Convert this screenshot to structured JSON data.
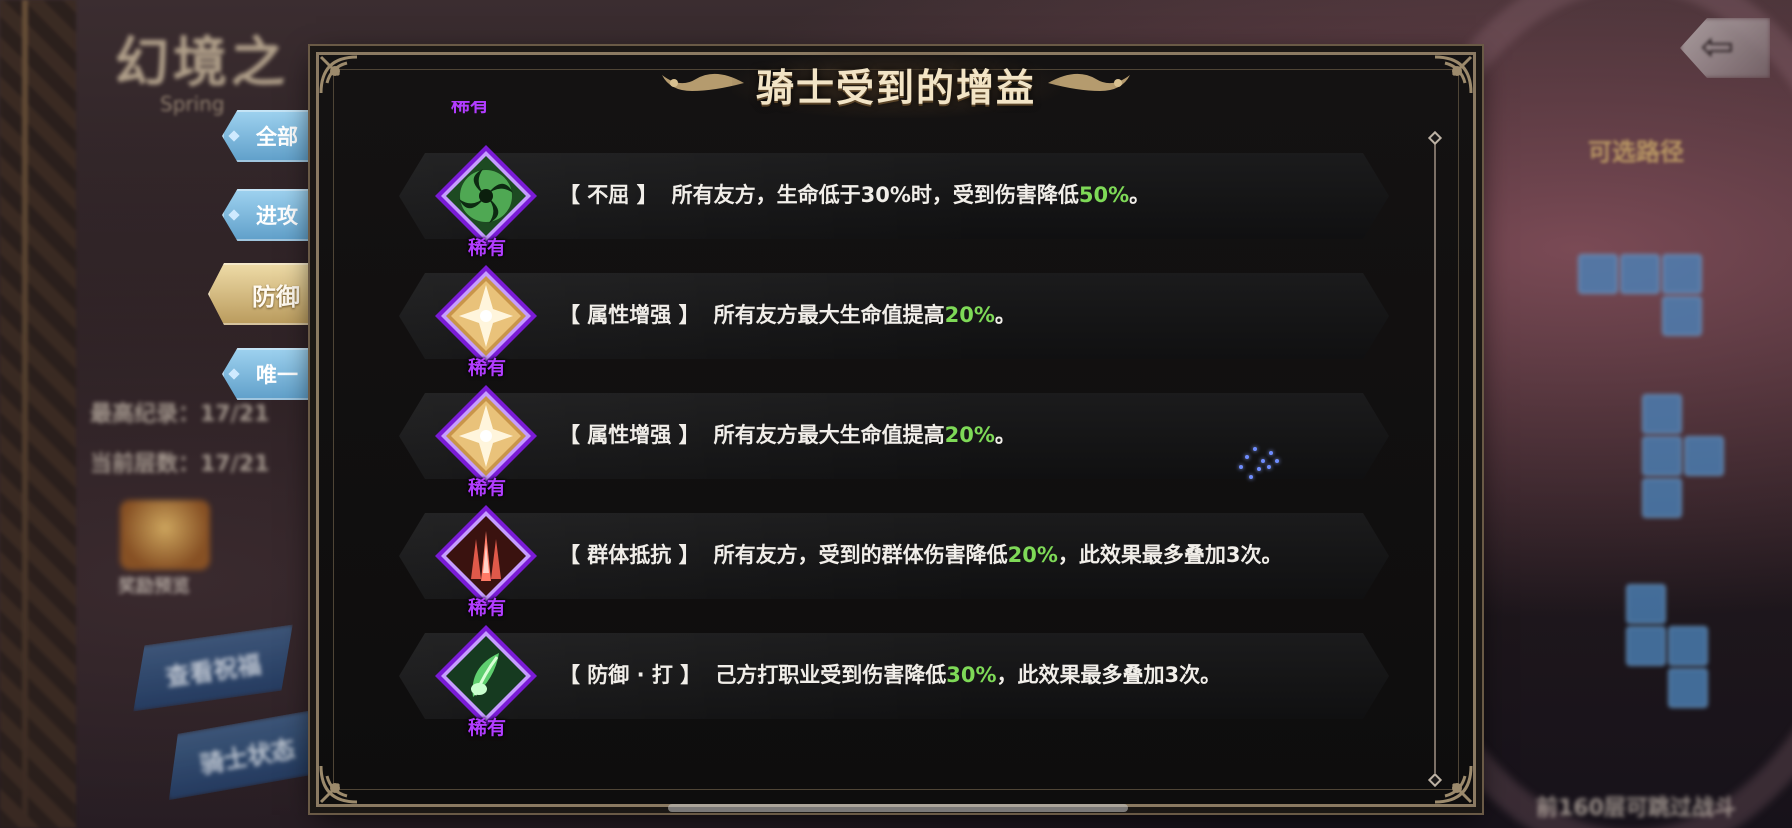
{
  "background": {
    "game_title": "幻境之",
    "game_subtitle": "Spring",
    "best_record": "最高纪录：17/21",
    "current_floor": "当前层数：17/21",
    "chest_label": "奖励预览",
    "view_blessing_button": "查看祝福",
    "knight_status_button": "骑士状态",
    "route_label": "可选路径",
    "bottom_note": "前160层可跳过战斗"
  },
  "tabs": [
    {
      "label": "全部",
      "active": false
    },
    {
      "label": "进攻",
      "active": false
    },
    {
      "label": "防御",
      "active": true
    },
    {
      "label": "唯一",
      "active": false
    }
  ],
  "dialog": {
    "title": "骑士受到的增益",
    "partial_top_rarity": "稀有",
    "buffs": [
      {
        "icon": "green-vortex-icon",
        "rarity": "稀有",
        "name": "【 不屈 】",
        "text_before": "所有友方，生命低于30%时，受到伤害降低",
        "highlight": "50%",
        "text_after": "。"
      },
      {
        "icon": "golden-crystal-icon",
        "rarity": "稀有",
        "name": "【 属性增强 】",
        "text_before": "所有友方最大生命值提高",
        "highlight": "20%",
        "text_after": "。"
      },
      {
        "icon": "golden-crystal-icon",
        "rarity": "稀有",
        "name": "【 属性增强 】",
        "text_before": "所有友方最大生命值提高",
        "highlight": "20%",
        "text_after": "。"
      },
      {
        "icon": "red-spikes-icon",
        "rarity": "稀有",
        "name": "【 群体抵抗 】",
        "text_before": "所有友方，受到的群体伤害降低",
        "highlight": "20%",
        "text_after": "，此效果最多叠加3次。"
      },
      {
        "icon": "green-leaf-icon",
        "rarity": "稀有",
        "name": "【 防御 · 打 】",
        "text_before": "己方打职业受到伤害降低",
        "highlight": "30%",
        "text_after": "，此效果最多叠加3次。"
      }
    ]
  },
  "colors": {
    "rarity_purple": "#b23cff",
    "highlight_green": "#7ed957",
    "tab_blue": "#5f9fc9",
    "tab_active_gold": "#b99a5c"
  }
}
